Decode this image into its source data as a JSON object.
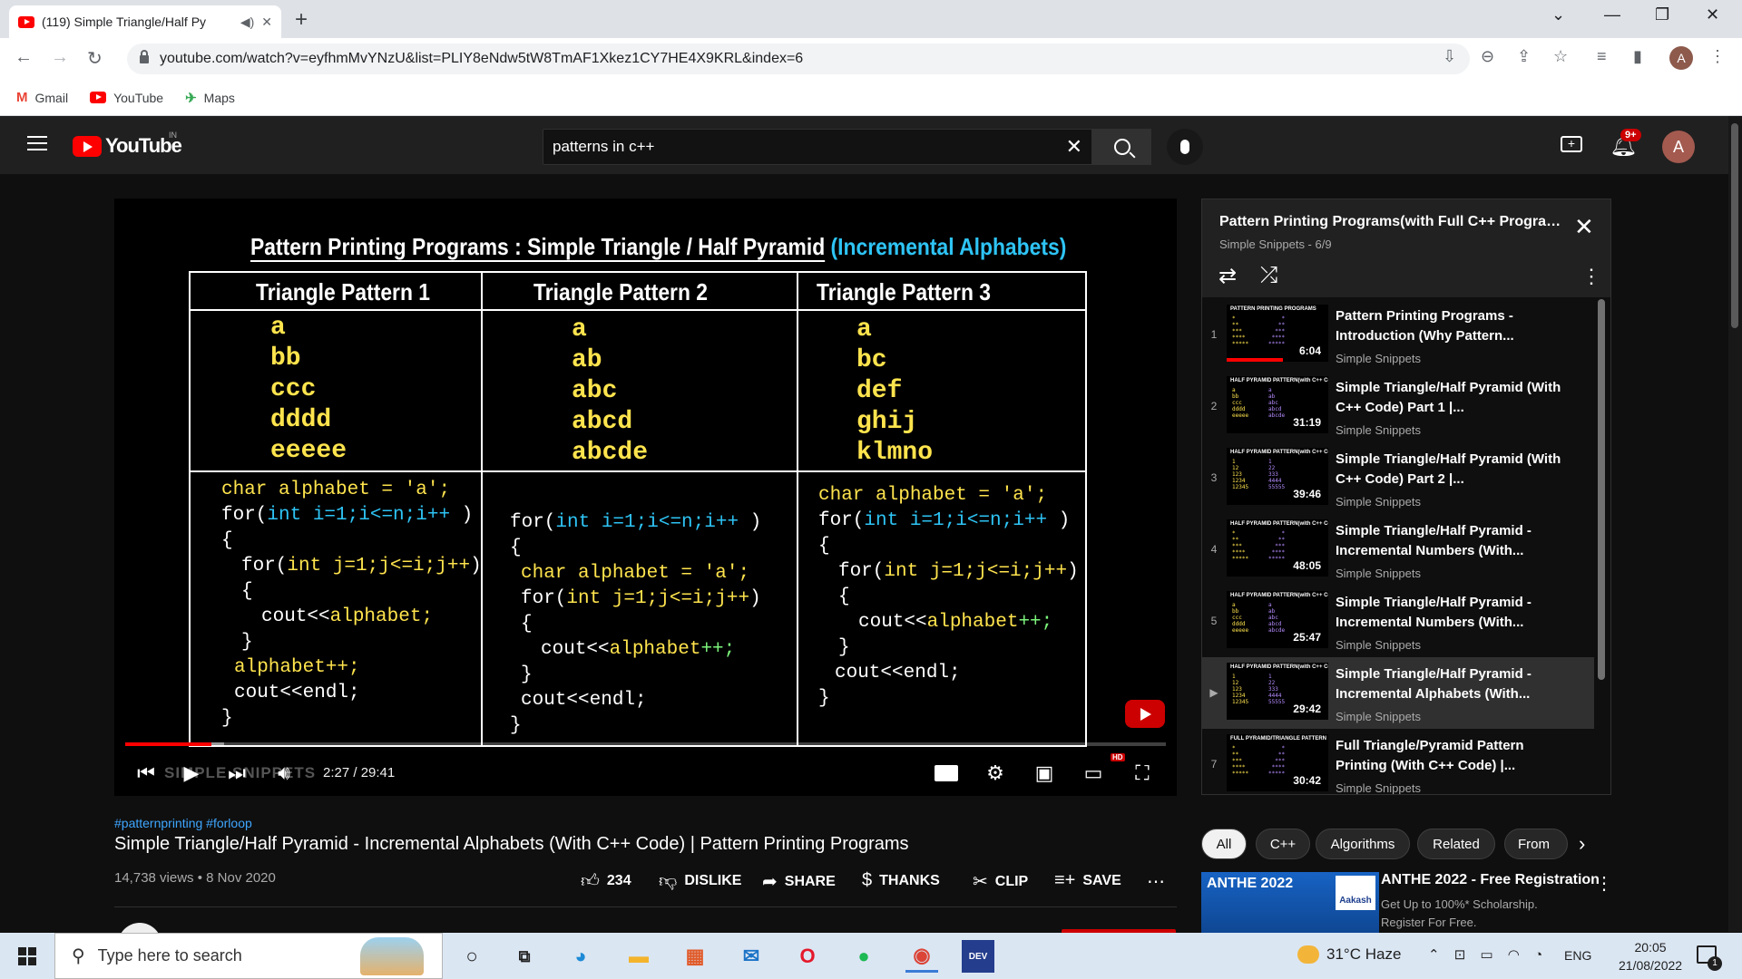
{
  "browser": {
    "tab_title": "(119) Simple Triangle/Half Py",
    "url": "youtube.com/watch?v=eyfhmMvYNzU&list=PLIY8eNdw5tW8TmAF1Xkez1CY7HE4X9KRL&index=6",
    "profile_initial": "A",
    "bookmarks": [
      {
        "label": "Gmail",
        "icon": "gmail-icon"
      },
      {
        "label": "YouTube",
        "icon": "youtube-icon"
      },
      {
        "label": "Maps",
        "icon": "maps-icon"
      }
    ]
  },
  "header": {
    "logo_text": "YouTube",
    "region": "IN",
    "search_value": "patterns in c++",
    "notification_count": "9+",
    "avatar_initial": "A"
  },
  "player": {
    "slide": {
      "title_main": "Pattern Printing Programs : Simple Triangle / Half Pyramid",
      "title_sub": "(Incremental Alphabets)",
      "columns": [
        {
          "header": "Triangle Pattern 1",
          "rows": [
            "a",
            "bb",
            "ccc",
            "dddd",
            "eeeee"
          ]
        },
        {
          "header": "Triangle Pattern 2",
          "rows": [
            "a",
            "ab",
            "abc",
            "abcd",
            "abcde"
          ]
        },
        {
          "header": "Triangle Pattern 3",
          "rows": [
            "a",
            "bc",
            "def",
            "ghij",
            "klmno"
          ]
        }
      ],
      "code": {
        "col1": {
          "l1": "char alphabet = 'a';",
          "l2a": "for(",
          "l2b": "int i=1;i<=n;i++",
          "l2c": " )",
          "l3": "{",
          "l4a": "for(",
          "l4b": "int j=1;j<=i;j++",
          "l4c": ")",
          "l5": "{",
          "l6a": "cout<<",
          "l6b": "alphabet;",
          "l7": "}",
          "l8": "alphabet++;",
          "l9": "cout<<endl;",
          "l10": "}"
        },
        "col2": {
          "l1a": "for(",
          "l1b": "int i=1;i<=n;i++",
          "l1c": " )",
          "l2": "{",
          "l3": "char alphabet = 'a';",
          "l4a": "for(",
          "l4b": "int j=1;j<=i;j++",
          "l4c": ")",
          "l5": "{",
          "l6a": "cout<<",
          "l6b": "alphabet",
          "l6c": "++;",
          "l7": "}",
          "l8": "cout<<endl;",
          "l9": "}"
        },
        "col3": {
          "l1": "char alphabet = 'a';",
          "l2a": "for(",
          "l2b": "int i=1;i<=n;i++",
          "l2c": " )",
          "l3": "{",
          "l4a": "for(",
          "l4b": "int j=1;j<=i;j++",
          "l4c": ")",
          "l5": "{",
          "l6a": "cout<<",
          "l6b": "alphabet",
          "l6c": "++;",
          "l7": "}",
          "l8": "cout<<endl;",
          "l9": "}"
        }
      }
    },
    "channel_watermark": "SIMPLE SNIPPETS",
    "time": "2:27 / 29:41",
    "progress_fraction": 0.0825,
    "loaded_fraction": 0.095,
    "hd_badge": "HD"
  },
  "video": {
    "hashtags": "#patternprinting #forloop",
    "title": "Simple Triangle/Half Pyramid - Incremental Alphabets (With C++ Code) | Pattern Printing Programs",
    "views_date": "14,738 views • 8 Nov 2020",
    "actions": [
      {
        "label": "234",
        "icon": "thumbs-up-icon"
      },
      {
        "label": "DISLIKE",
        "icon": "thumbs-down-icon"
      },
      {
        "label": "SHARE",
        "icon": "share-icon"
      },
      {
        "label": "THANKS",
        "icon": "thanks-icon"
      },
      {
        "label": "CLIP",
        "icon": "scissors-icon"
      },
      {
        "label": "SAVE",
        "icon": "save-icon"
      }
    ]
  },
  "playlist": {
    "title": "Pattern Printing Programs(with Full C++ Program C...",
    "subtitle": "Simple Snippets - 6/9",
    "items": [
      {
        "index": "1",
        "title": "Pattern Printing Programs - Introduction (Why Pattern...",
        "channel": "Simple Snippets",
        "duration": "6:04",
        "thumb_head": "PATTERN PRINTING PROGRAMS",
        "watched_fraction": 0.55
      },
      {
        "index": "2",
        "title": "Simple Triangle/Half Pyramid (With C++ Code) Part 1 |...",
        "channel": "Simple Snippets",
        "duration": "31:19",
        "thumb_head": "HALF PYRAMID PATTERN(with C++ Code)",
        "watched_fraction": 0
      },
      {
        "index": "3",
        "title": "Simple Triangle/Half Pyramid (With C++ Code) Part 2 |...",
        "channel": "Simple Snippets",
        "duration": "39:46",
        "thumb_head": "HALF PYRAMID PATTERN(with C++ Code)",
        "watched_fraction": 0
      },
      {
        "index": "4",
        "title": "Simple Triangle/Half Pyramid - Incremental Numbers (With...",
        "channel": "Simple Snippets",
        "duration": "48:05",
        "thumb_head": "HALF PYRAMID PATTERN(with C++ Code)",
        "watched_fraction": 0
      },
      {
        "index": "5",
        "title": "Simple Triangle/Half Pyramid - Incremental Numbers (With...",
        "channel": "Simple Snippets",
        "duration": "25:47",
        "thumb_head": "HALF PYRAMID PATTERN(with C++ Code)",
        "watched_fraction": 0
      },
      {
        "index": "▶",
        "title": "Simple Triangle/Half Pyramid - Incremental Alphabets (With...",
        "channel": "Simple Snippets",
        "duration": "29:42",
        "thumb_head": "HALF PYRAMID PATTERN(with C++ Code)",
        "watched_fraction": 0
      },
      {
        "index": "7",
        "title": "Full Triangle/Pyramid Pattern Printing (With C++ Code) |...",
        "channel": "Simple Snippets",
        "duration": "30:42",
        "thumb_head": "FULL PYRAMID/TRIANGLE PATTERN",
        "watched_fraction": 0
      }
    ]
  },
  "chips": [
    "All",
    "C++",
    "Algorithms",
    "Related",
    "From"
  ],
  "ad": {
    "brand": "ANTHE 2022",
    "logo": "Aakash",
    "title": "ANTHE 2022 - Free Registration",
    "desc1": "Get Up to 100%* Scholarship.",
    "desc2": "Register For Free."
  },
  "taskbar": {
    "search_placeholder": "Type here to search",
    "weather": "31°C  Haze",
    "lang": "ENG",
    "time": "20:05",
    "date": "21/08/2022",
    "notif_count": "1"
  }
}
